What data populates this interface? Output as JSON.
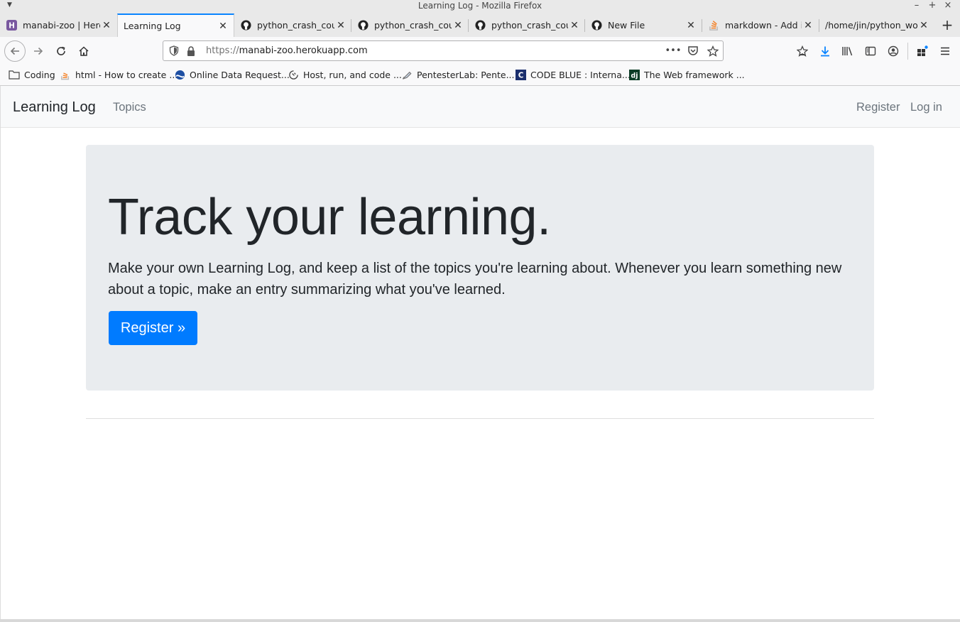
{
  "window": {
    "title": "Learning Log - Mozilla Firefox",
    "minimize": "–",
    "maximize": "+",
    "close": "×"
  },
  "tabs": [
    {
      "label": "manabi-zoo | Herc",
      "icon": "heroku-icon"
    },
    {
      "label": "Learning Log",
      "icon": "none",
      "active": true
    },
    {
      "label": "python_crash_cou",
      "icon": "github-icon"
    },
    {
      "label": "python_crash_cou",
      "icon": "github-icon"
    },
    {
      "label": "python_crash_cou",
      "icon": "github-icon"
    },
    {
      "label": "New File",
      "icon": "github-icon"
    },
    {
      "label": "markdown - Add i",
      "icon": "stackoverflow-icon"
    },
    {
      "label": "/home/jin/python_wo",
      "icon": "none"
    }
  ],
  "newtab": "+",
  "urlbar": {
    "scheme": "https://",
    "host": "manabi-zoo.herokuapp.com",
    "more": "•••"
  },
  "bookmarks": [
    {
      "label": "Coding",
      "icon": "folder-icon"
    },
    {
      "label": "html - How to create ...",
      "icon": "stackoverflow-icon"
    },
    {
      "label": "Online Data Request...",
      "icon": "noaa-icon"
    },
    {
      "label": "Host, run, and code ...",
      "icon": "replit-icon"
    },
    {
      "label": "PentesterLab: Pente...",
      "icon": "pentesterlab-icon"
    },
    {
      "label": "CODE BLUE : Interna...",
      "icon": "codeblue-icon"
    },
    {
      "label": "The Web framework ...",
      "icon": "django-icon"
    }
  ],
  "site": {
    "brand": "Learning Log",
    "nav_topics": "Topics",
    "nav_register": "Register",
    "nav_login": "Log in",
    "heading": "Track your learning.",
    "lead": "Make your own Learning Log, and keep a list of the topics you're learning about. Whenever you learn something new about a topic, make an entry summarizing what you've learned.",
    "register_button": "Register »"
  },
  "colors": {
    "accent": "#0a84ff",
    "primary_button": "#007bff",
    "jumbotron_bg": "#e9ecef",
    "site_nav_bg": "#f8f9fa"
  }
}
